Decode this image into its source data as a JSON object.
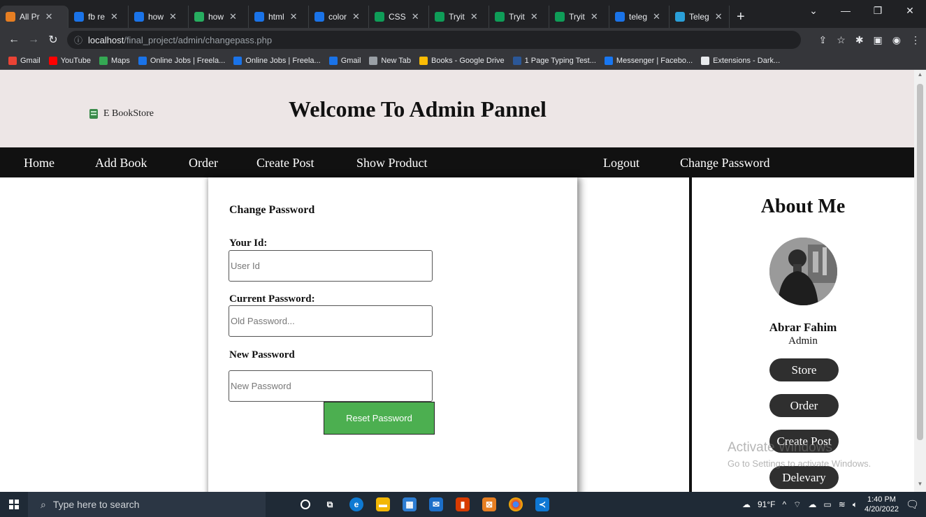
{
  "browser": {
    "tabs": [
      {
        "label": "All Pr",
        "color": "#e67e22",
        "active": true
      },
      {
        "label": "fb re",
        "color": "#1a73e8"
      },
      {
        "label": "how",
        "color": "#1a73e8"
      },
      {
        "label": "how",
        "color": "#27ae60"
      },
      {
        "label": "html",
        "color": "#1a73e8"
      },
      {
        "label": "color",
        "color": "#1a73e8"
      },
      {
        "label": "CSS",
        "color": "#0f9d58"
      },
      {
        "label": "Tryit",
        "color": "#0f9d58"
      },
      {
        "label": "Tryit",
        "color": "#0f9d58"
      },
      {
        "label": "Tryit",
        "color": "#0f9d58"
      },
      {
        "label": "teleg",
        "color": "#1a73e8"
      },
      {
        "label": "Teleg",
        "color": "#2a9fd8"
      }
    ],
    "new_tab": "+",
    "url_host": "localhost",
    "url_path": "/final_project/admin/changepass.php",
    "bookmarks": [
      {
        "label": "Gmail",
        "color": "#ea4335"
      },
      {
        "label": "YouTube",
        "color": "#ff0000"
      },
      {
        "label": "Maps",
        "color": "#34a853"
      },
      {
        "label": "Online Jobs | Freela...",
        "color": "#1a73e8"
      },
      {
        "label": "Online Jobs | Freela...",
        "color": "#1a73e8"
      },
      {
        "label": "Gmail",
        "color": "#1a73e8"
      },
      {
        "label": "New Tab",
        "color": "#9aa0a6"
      },
      {
        "label": "Books - Google Drive",
        "color": "#fbbc04"
      },
      {
        "label": "1 Page Typing Test...",
        "color": "#2b5797"
      },
      {
        "label": "Messenger | Facebo...",
        "color": "#1877f2"
      },
      {
        "label": "Extensions - Dark...",
        "color": "#e8eaed"
      }
    ]
  },
  "site": {
    "logo_text": "E BookStore",
    "title": "Welcome To Admin Pannel",
    "nav": {
      "home": "Home",
      "add_book": "Add Book",
      "order": "Order",
      "create_post": "Create Post",
      "show_product": "Show Product",
      "logout": "Logout",
      "change_password": "Change Password"
    }
  },
  "form": {
    "title": "Change Password",
    "id_label": "Your Id:",
    "id_placeholder": "User Id",
    "current_label": "Current Password:",
    "current_placeholder": "Old Password...",
    "new_label": "New Password",
    "new_placeholder": "New Password",
    "submit_label": "Reset Password"
  },
  "sidebar": {
    "title": "About Me",
    "name": "Abrar Fahim",
    "role": "Admin",
    "buttons": [
      "Store",
      "Order",
      "Create Post",
      "Delevary"
    ]
  },
  "watermark": {
    "line1": "Activate Windows",
    "line2": "Go to Settings to activate Windows."
  },
  "taskbar": {
    "search_placeholder": "Type here to search",
    "weather": "91°F",
    "time": "1:40 PM",
    "date": "4/20/2022"
  },
  "colors": {
    "header_bg": "#ede6e6",
    "nav_bg": "#111111",
    "button_green": "#4caf50",
    "sidebar_button": "#2f2f2f"
  }
}
